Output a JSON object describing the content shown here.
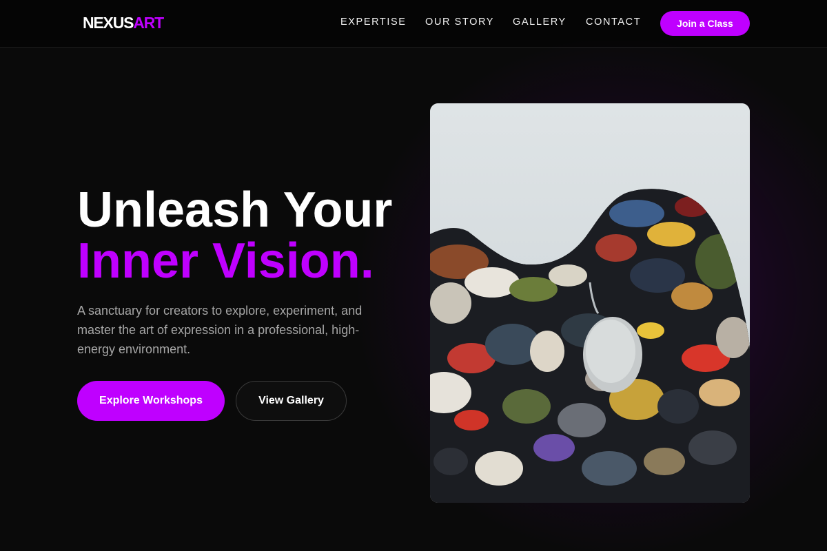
{
  "brand": {
    "part1": "NEXUS",
    "part2": "ART",
    "accent": "#bf00ff"
  },
  "nav": {
    "links": [
      "EXPERTISE",
      "OUR STORY",
      "GALLERY",
      "CONTACT"
    ],
    "cta": "Join a Class"
  },
  "hero": {
    "title_line1": "Unleash Your",
    "title_line2": "Inner Vision.",
    "subtitle": "A sanctuary for creators to explore, experiment, and master the art of expression in a professional, high-energy environment.",
    "primary_button": "Explore Workshops",
    "secondary_button": "View Gallery",
    "image_icon": "paint-palette-photo"
  },
  "colors": {
    "background": "#0a0a0a",
    "accent": "#bf00ff",
    "text": "#ffffff",
    "muted_text": "#a6a6a6"
  }
}
